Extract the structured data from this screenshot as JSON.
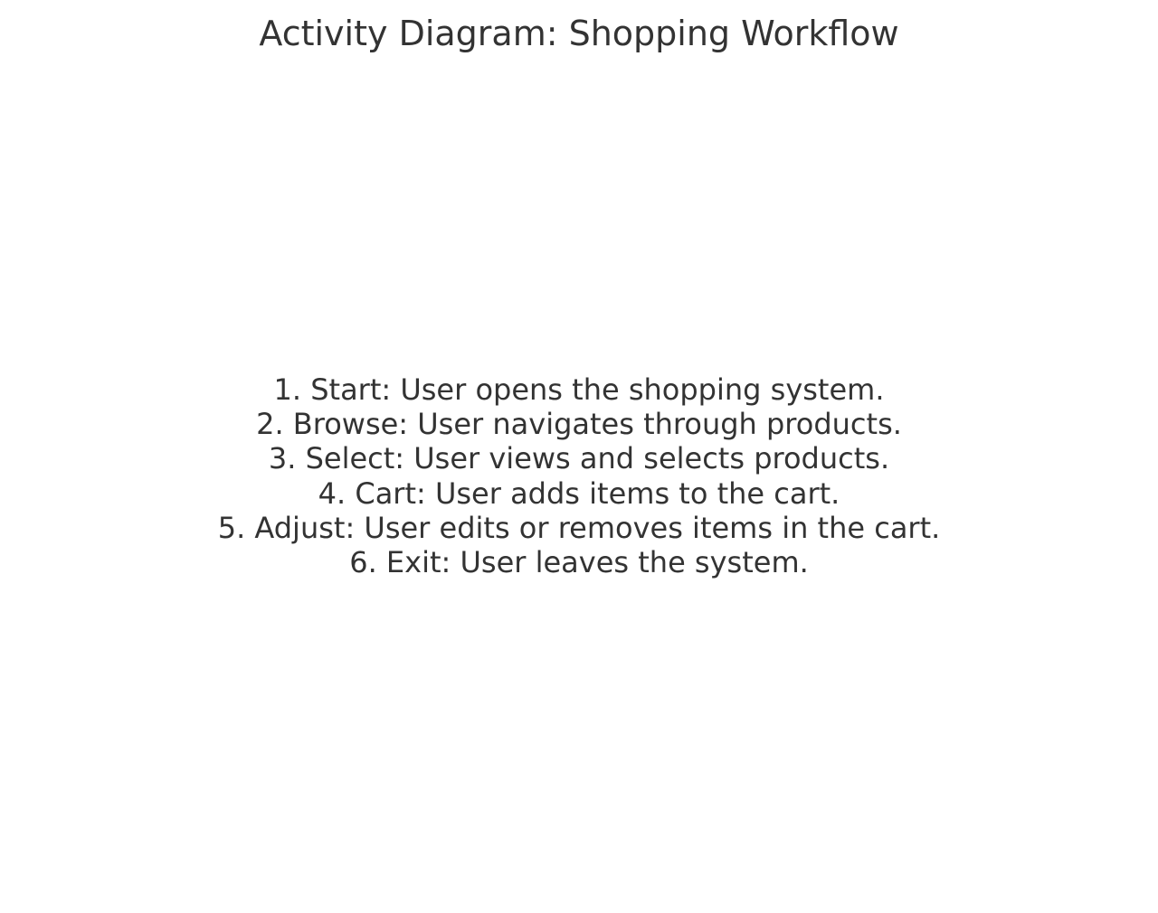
{
  "title": "Activity Diagram: Shopping Workflow",
  "steps": [
    "1. Start: User opens the shopping system.",
    "2. Browse: User navigates through products.",
    "3. Select: User views and selects products.",
    "4. Cart: User adds items to the cart.",
    "5. Adjust: User edits or removes items in the cart.",
    "6. Exit: User leaves the system."
  ],
  "colors": {
    "text": "#333333",
    "background": "#ffffff"
  }
}
